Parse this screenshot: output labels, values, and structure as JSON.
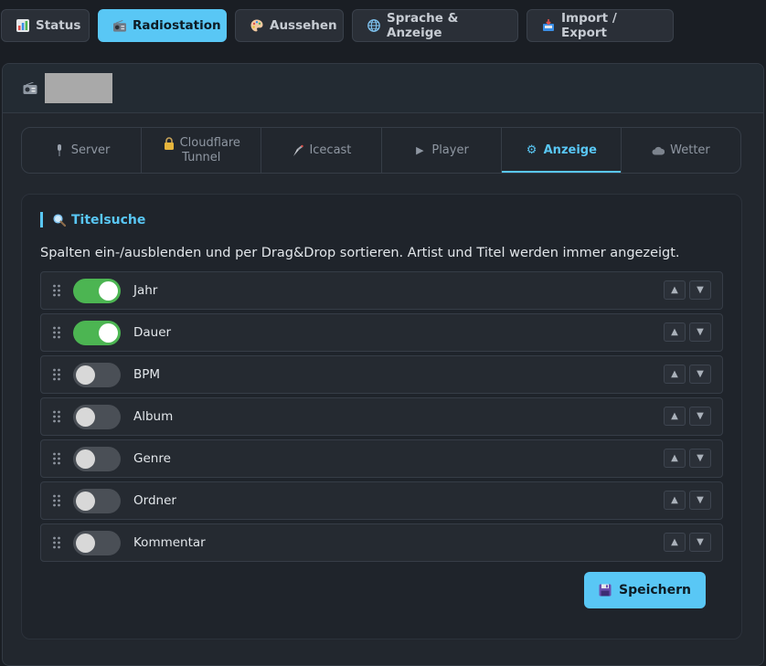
{
  "top_tabs": [
    {
      "label": "Status",
      "icon": "bar-chart-icon"
    },
    {
      "label": "Radiostation",
      "icon": "radio-icon",
      "active": true
    },
    {
      "label": "Aussehen",
      "icon": "palette-icon"
    },
    {
      "label": "Sprache & Anzeige",
      "icon": "globe-icon"
    },
    {
      "label": "Import / Export",
      "icon": "inbox-icon"
    }
  ],
  "panel": {
    "icon": "radio-icon"
  },
  "sub_tabs": [
    {
      "label": "Server",
      "icon": "microphone-icon"
    },
    {
      "label_line1": "Cloudflare",
      "label_line2": "Tunnel",
      "icon": "lock-icon"
    },
    {
      "label": "Icecast",
      "icon": "broadcast-icon"
    },
    {
      "label": "Player",
      "icon": "play-icon"
    },
    {
      "label": "Anzeige",
      "icon": "gear-icon",
      "active": true
    },
    {
      "label": "Wetter",
      "icon": "cloud-icon"
    }
  ],
  "section": {
    "title": "Titelsuche",
    "title_icon": "magnifier-icon",
    "description": "Spalten ein-/ausblenden und per Drag&Drop sortieren. Artist und Titel werden immer angezeigt."
  },
  "columns": [
    {
      "label": "Jahr",
      "enabled": true
    },
    {
      "label": "Dauer",
      "enabled": true
    },
    {
      "label": "BPM",
      "enabled": false
    },
    {
      "label": "Album",
      "enabled": false
    },
    {
      "label": "Genre",
      "enabled": false
    },
    {
      "label": "Ordner",
      "enabled": false
    },
    {
      "label": "Kommentar",
      "enabled": false
    }
  ],
  "arrows": {
    "up": "▲",
    "down": "▼"
  },
  "save_button": {
    "label": "Speichern",
    "icon": "floppy-disk-icon"
  },
  "colors": {
    "accent": "#59c7f5",
    "toggle_on": "#4cb552",
    "toggle_off": "#4a4f56"
  }
}
